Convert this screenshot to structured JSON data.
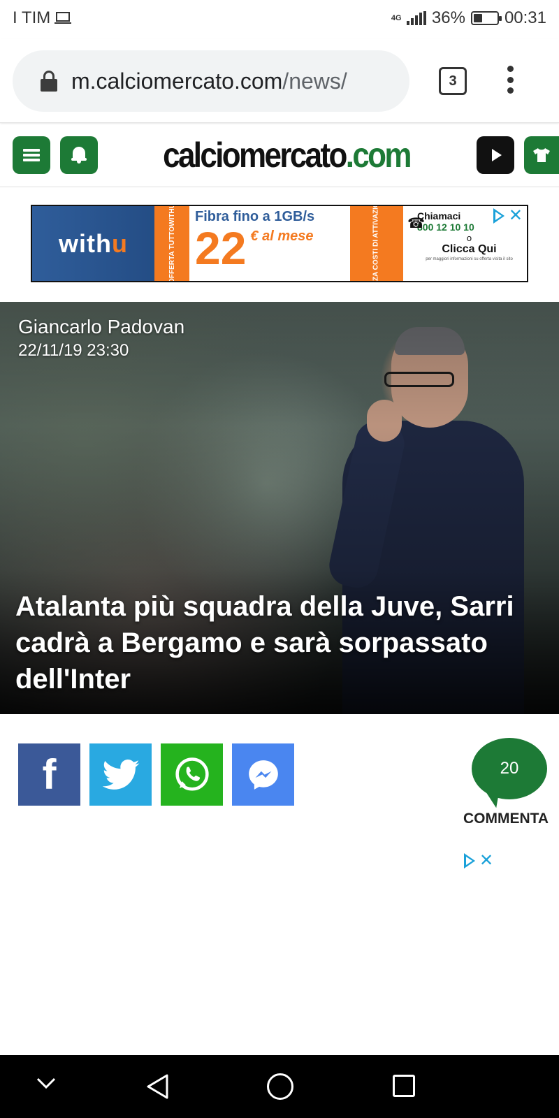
{
  "status_bar": {
    "carrier": "I TIM",
    "network": "4G",
    "battery_percent": "36%",
    "battery_level": 0.36,
    "time": "00:31"
  },
  "browser": {
    "url_domain": "m.calciomercato.com",
    "url_path": "/news/",
    "tab_count": "3"
  },
  "site": {
    "logo_main": "calciomercato",
    "logo_tld": ".com",
    "brand_color": "#1d7a36"
  },
  "ad": {
    "brand": "with",
    "brand_u": "u",
    "vertical_text_1": "OFFERTA TUTTOWITHU",
    "headline": "Fibra fino a 1GB/s",
    "price": "22",
    "price_unit": "€ al mese",
    "vertical_text_2": "SENZA COSTI DI ATTIVAZIONE",
    "call_label": "Chiamaci",
    "phone": "800 12 10 10",
    "or_label": "o",
    "cta": "Clicca Qui",
    "fine_print": "per maggiori informazioni su offerta visita il sito"
  },
  "article": {
    "author": "Giancarlo Padovan",
    "datetime": "22/11/19 23:30",
    "title": "Atalanta più squadra della Juve, Sarri cadrà a Bergamo e sarà sorpassato dell'Inter"
  },
  "share": {
    "facebook_glyph": "f",
    "comment_count": "20",
    "comment_label": "COMMENTA"
  },
  "icons": {
    "menu": "menu-icon",
    "notifications": "bell-icon",
    "video": "play-icon",
    "shop": "shirt-icon",
    "facebook": "facebook-icon",
    "twitter": "twitter-icon",
    "whatsapp": "whatsapp-icon",
    "messenger": "messenger-icon",
    "adchoices": "adchoices-icon"
  }
}
